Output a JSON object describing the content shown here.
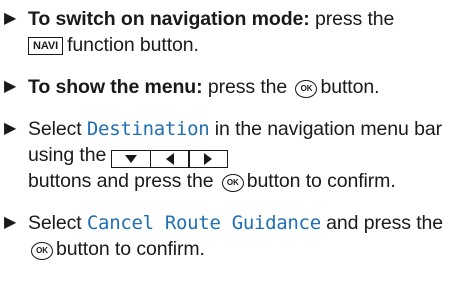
{
  "steps": [
    {
      "bold": "To switch on navigation mode:",
      "text1": " press the",
      "key": "NAVI",
      "text2": "function button."
    },
    {
      "bold": "To show the menu:",
      "text1": " press the",
      "ok": "OK",
      "text2": "button."
    },
    {
      "text1": "Select ",
      "menu_item": "Destination",
      "text2": " in the navigation menu bar using the",
      "arrow_icons": [
        "arrow-down-icon",
        "arrow-left-icon",
        "arrow-right-icon"
      ],
      "text3": "buttons and press the",
      "ok": "OK",
      "text4": "button to confirm."
    },
    {
      "text1": "Select ",
      "menu_item": "Cancel Route Guidance",
      "text2": " and press the",
      "ok": "OK",
      "text3": "button to confirm."
    }
  ],
  "colors": {
    "text": "#1a1a1a",
    "menu_item": "#1f6fb5"
  }
}
